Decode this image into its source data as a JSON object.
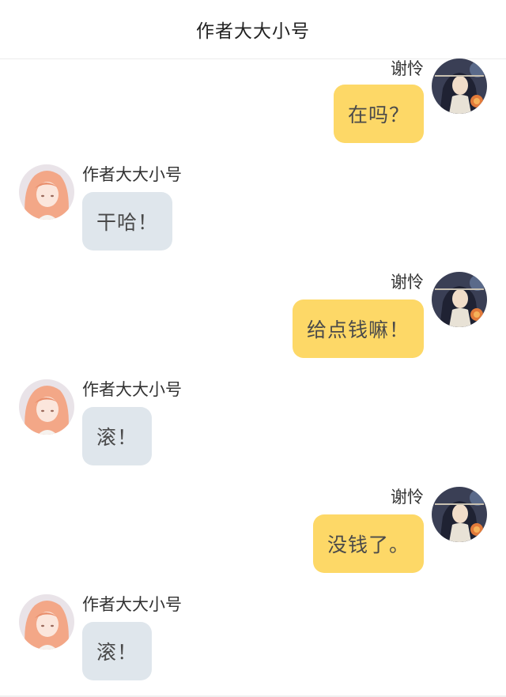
{
  "header": {
    "title": "作者大大小号"
  },
  "messages": [
    {
      "side": "right",
      "sender": "谢怜",
      "text": "在吗？"
    },
    {
      "side": "left",
      "sender": "作者大大小号",
      "text": "干哈！"
    },
    {
      "side": "right",
      "sender": "谢怜",
      "text": "给点钱嘛！"
    },
    {
      "side": "left",
      "sender": "作者大大小号",
      "text": "滚！"
    },
    {
      "side": "right",
      "sender": "谢怜",
      "text": "没钱了。"
    },
    {
      "side": "left",
      "sender": "作者大大小号",
      "text": "滚！"
    }
  ],
  "colors": {
    "self_bubble": "#fdd867",
    "other_bubble": "#dfe6ec"
  },
  "avatars": {
    "self": "avatar-dark-haired-figure-with-lantern",
    "other": "avatar-peach-haired-girl"
  }
}
